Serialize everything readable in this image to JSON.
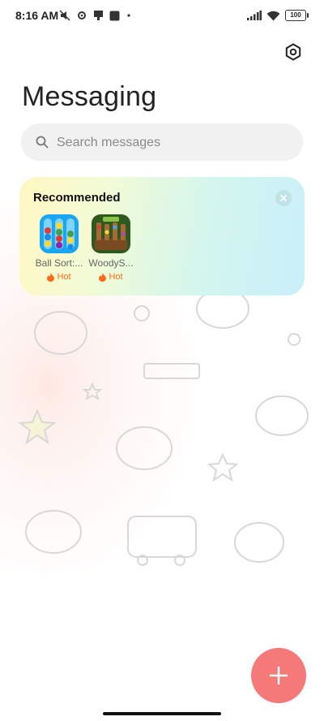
{
  "status_bar": {
    "time": "8:16 AM",
    "battery": "100",
    "icons": [
      "mute-icon",
      "settings-gear-icon",
      "sim-icon",
      "square-icon",
      "dot-icon",
      "signal-icon",
      "wifi-icon",
      "battery-icon"
    ]
  },
  "header": {
    "title": "Messaging",
    "settings_icon": "gear-icon"
  },
  "search": {
    "placeholder": "Search messages",
    "value": ""
  },
  "recommended": {
    "title": "Recommended",
    "apps": [
      {
        "name": "Ball Sort:...",
        "tag": "Hot",
        "icon": "ball-sort-icon"
      },
      {
        "name": "WoodyS...",
        "tag": "Hot",
        "icon": "woody-icon"
      }
    ]
  },
  "fab": {
    "icon": "plus-icon"
  },
  "colors": {
    "fab": "#f57979",
    "tag": "#ff6b1a",
    "title": "#222222"
  }
}
